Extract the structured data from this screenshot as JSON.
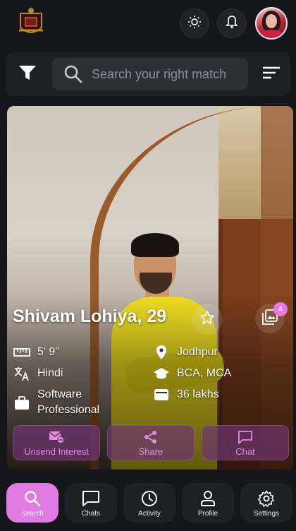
{
  "topbar": {
    "logo_icon": "crest-logo-icon",
    "theme_icon": "sun-icon",
    "notification_icon": "bell-icon",
    "avatar_icon": "user-avatar"
  },
  "search": {
    "placeholder": "Search your right match",
    "value": "",
    "filter_icon": "filter-icon",
    "sort_icon": "sort-lines-icon"
  },
  "profile": {
    "name_age": "Shivam Lohiya, 29",
    "photo_count": "4",
    "height": "5' 9\"",
    "location": "Jodhpur",
    "language": "Hindi",
    "education": "BCA, MCA",
    "profession": "Software Professional",
    "income": "36 lakhs"
  },
  "actions": [
    {
      "label": "Unsend Interest",
      "icon": "mail-cancel-icon"
    },
    {
      "label": "Share",
      "icon": "share-icon"
    },
    {
      "label": "Chat",
      "icon": "chat-bubble-icon"
    }
  ],
  "nav": [
    {
      "label": "Search",
      "icon": "search-icon",
      "active": true
    },
    {
      "label": "Chats",
      "icon": "chat-icon",
      "active": false
    },
    {
      "label": "Activity",
      "icon": "clock-icon",
      "active": false
    },
    {
      "label": "Profile",
      "icon": "person-icon",
      "active": false
    },
    {
      "label": "Settings",
      "icon": "gear-icon",
      "active": false
    }
  ],
  "colors": {
    "background": "#14161b",
    "accent": "#e27ae3",
    "action_bg": "#6e346e",
    "photo_shirt": "#f2e023"
  }
}
